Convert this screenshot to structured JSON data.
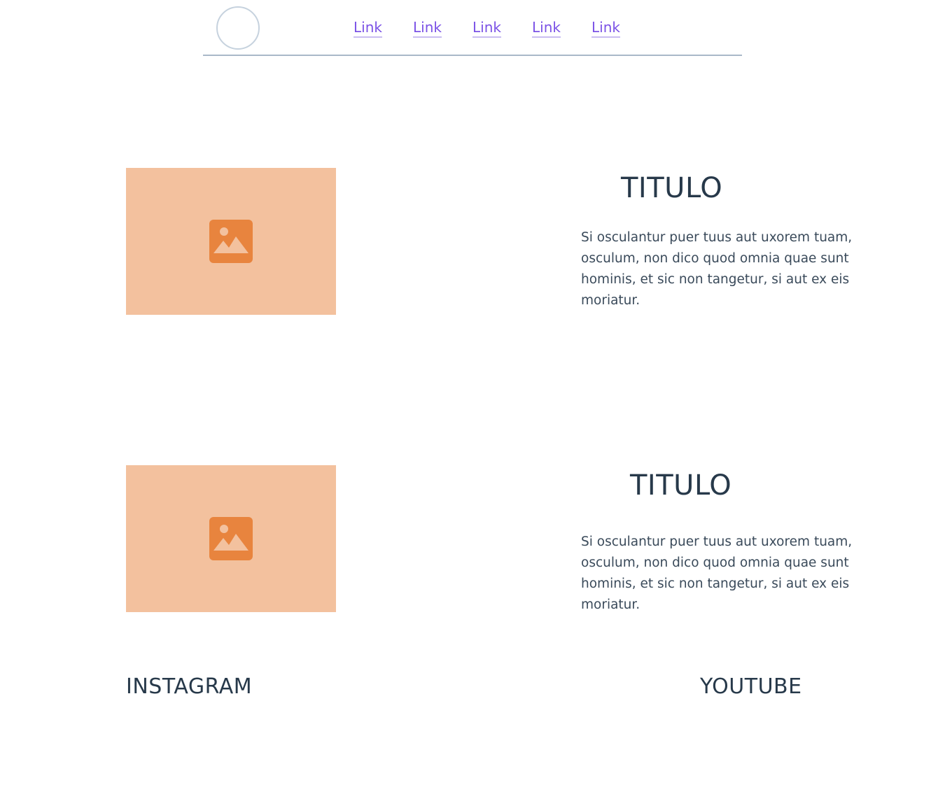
{
  "header": {
    "nav_links": [
      "Link",
      "Link",
      "Link",
      "Link",
      "Link"
    ]
  },
  "sections": [
    {
      "title": "TITULO",
      "body": "Si osculantur puer tuus aut uxorem tuam, osculum, non dico quod omnia quae sunt hominis, et sic non tangetur, si aut ex eis moriatur."
    },
    {
      "title": "TITULO",
      "body": "Si osculantur puer tuus aut uxorem tuam, osculum, non dico quod omnia quae sunt hominis, et sic non tangetur, si aut ex eis moriatur."
    }
  ],
  "footer": {
    "instagram_label": "INSTAGRAM",
    "youtube_label": "YOUTUBE"
  },
  "colors": {
    "placeholder_bg": "#f3c19e",
    "placeholder_icon": "#e8843e",
    "link": "#7b52e6",
    "text": "#27394a",
    "divider": "#a9b8c8"
  },
  "icons": {
    "logo": "circle-logo",
    "image": "image-placeholder-icon"
  }
}
